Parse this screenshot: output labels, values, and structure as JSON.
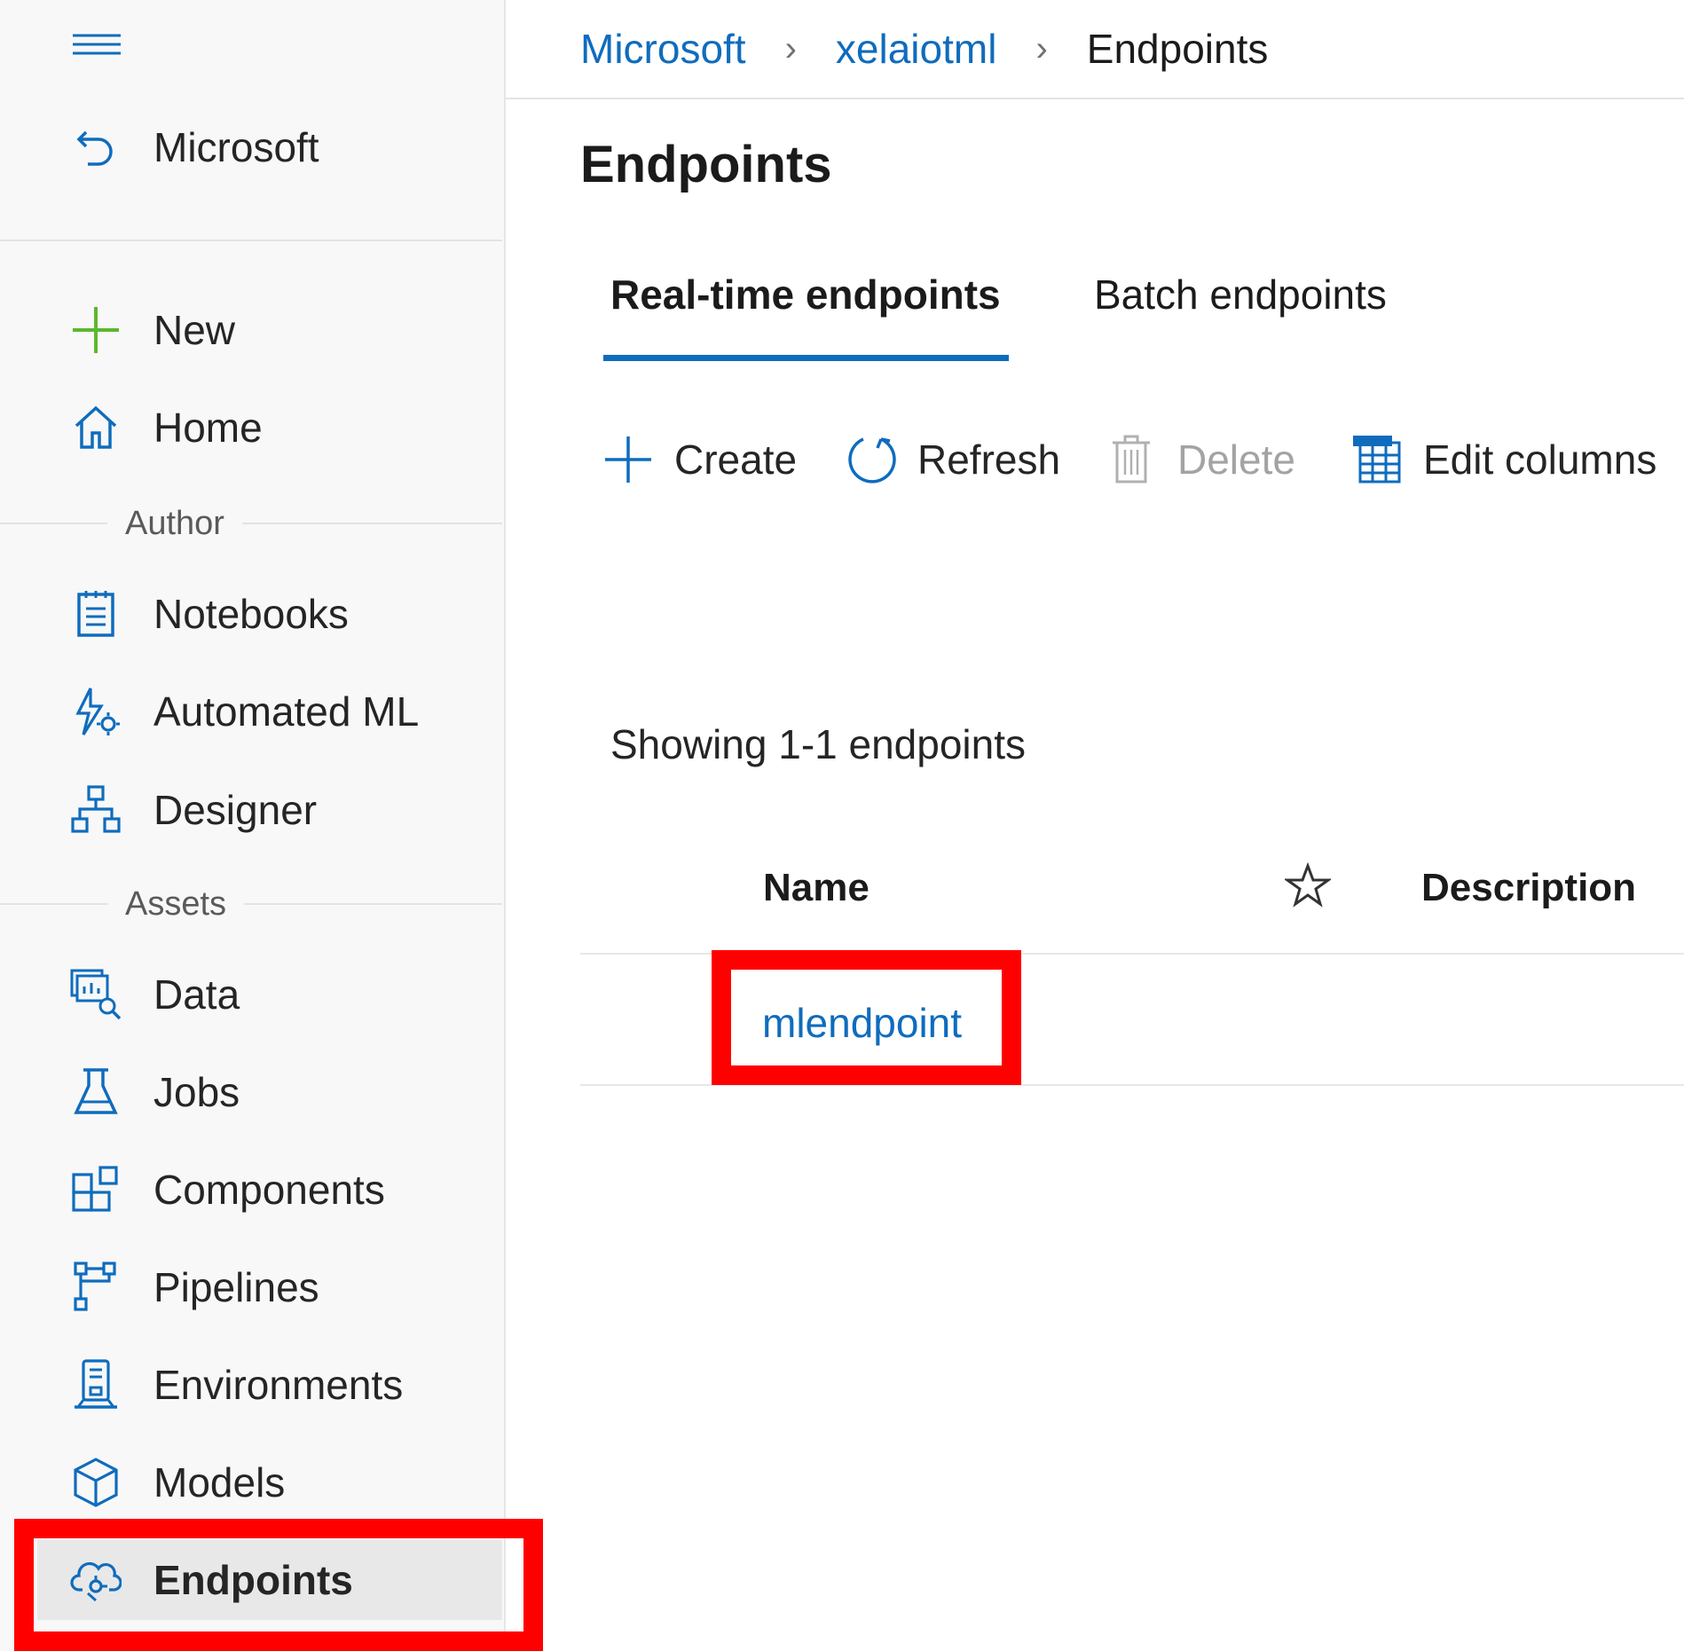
{
  "breadcrumb": {
    "items": [
      "Microsoft",
      "xelaiotml"
    ],
    "current": "Endpoints"
  },
  "sidebar": {
    "workspace": "Microsoft",
    "new_label": "New",
    "home_label": "Home",
    "author_section": "Author",
    "author_items": [
      "Notebooks",
      "Automated ML",
      "Designer"
    ],
    "assets_section": "Assets",
    "asset_items": [
      "Data",
      "Jobs",
      "Components",
      "Pipelines",
      "Environments",
      "Models",
      "Endpoints"
    ],
    "selected": "Endpoints"
  },
  "page": {
    "title": "Endpoints",
    "tabs": [
      "Real-time endpoints",
      "Batch endpoints"
    ],
    "active_tab": "Real-time endpoints"
  },
  "toolbar": {
    "create": "Create",
    "refresh": "Refresh",
    "delete": "Delete",
    "edit_columns": "Edit columns"
  },
  "table": {
    "showing_text": "Showing 1-1 endpoints",
    "columns": [
      "Name",
      "Description"
    ],
    "rows": [
      {
        "name": "mlendpoint"
      }
    ]
  },
  "colors": {
    "accent": "#0f6cbd",
    "highlight": "#ff0000",
    "new_icon": "#5cb82e"
  },
  "icons": {
    "menu": "hamburger-icon",
    "back": "back-arrow-icon",
    "new": "plus-icon",
    "home": "home-icon",
    "notebooks": "notebook-icon",
    "automated_ml": "automated-ml-icon",
    "designer": "designer-icon",
    "data": "data-icon",
    "jobs": "flask-icon",
    "components": "components-icon",
    "pipelines": "pipelines-icon",
    "environments": "environments-icon",
    "models": "cube-icon",
    "endpoints": "cloud-endpoint-icon",
    "star": "star-icon"
  }
}
